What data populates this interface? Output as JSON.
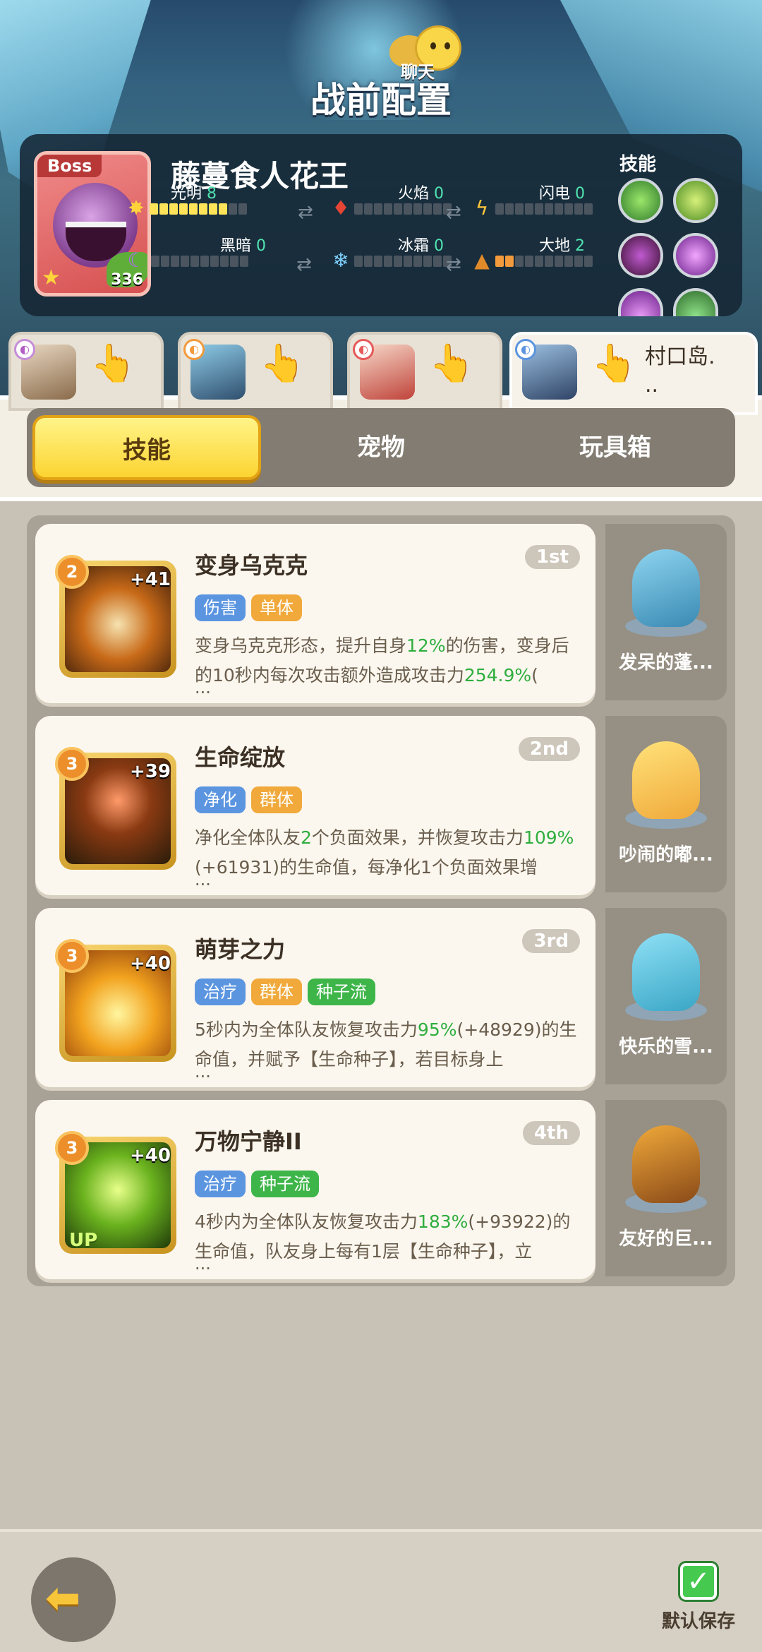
{
  "header": {
    "title": "战前配置",
    "chat_label": "聊天"
  },
  "boss": {
    "badge": "Boss",
    "name": "藤蔓食人花王",
    "level": "336",
    "skills_label": "技能",
    "attributes": [
      {
        "name": "光明",
        "value": "8"
      },
      {
        "name": "火焰",
        "value": "0"
      },
      {
        "name": "闪电",
        "value": "0"
      },
      {
        "name": "黑暗",
        "value": "0"
      },
      {
        "name": "冰霜",
        "value": "0"
      },
      {
        "name": "大地",
        "value": "2"
      }
    ]
  },
  "party_tabs": [
    {
      "name": ""
    },
    {
      "name": ""
    },
    {
      "name": ""
    },
    {
      "name": "村口岛.\n.."
    }
  ],
  "segments": [
    "技能",
    "宠物",
    "玩具箱"
  ],
  "skills": [
    {
      "level": "2",
      "plus": "+41",
      "name": "变身乌克克",
      "rank": "1st",
      "tags": [
        "伤害",
        "单体"
      ],
      "desc_a": "变身乌克克形态，提升自身",
      "desc_b": "12%",
      "desc_c": "的伤害，变身后的10秒内每次攻击额外造成攻击力",
      "desc_d": "254.9%",
      "desc_e": "(",
      "dots": "...",
      "pet": "发呆的蓬..."
    },
    {
      "level": "3",
      "plus": "+39",
      "name": "生命绽放",
      "rank": "2nd",
      "tags": [
        "净化",
        "群体"
      ],
      "desc_a": "净化全体队友",
      "desc_b": "2",
      "desc_c": "个负面效果，并恢复攻击力",
      "desc_d": "109%",
      "desc_e": "(+61931)的生命值，每净化1个负面效果增",
      "dots": "...",
      "pet": "吵闹的嘟..."
    },
    {
      "level": "3",
      "plus": "+40",
      "name": "萌芽之力",
      "rank": "3rd",
      "tags": [
        "治疗",
        "群体",
        "种子流"
      ],
      "desc_a": "5秒内为全体队友恢复攻击力",
      "desc_b": "95%",
      "desc_c": "(+48929)",
      "desc_d": "",
      "desc_e": "的生命值，并赋予【生命种子】，若目标身上",
      "dots": "...",
      "pet": "快乐的雪..."
    },
    {
      "level": "3",
      "plus": "+40",
      "up": "UP",
      "name": "万物宁静II",
      "rank": "4th",
      "tags": [
        "治疗",
        "种子流"
      ],
      "desc_a": "4秒内为全体队友恢复攻击力",
      "desc_b": "183%",
      "desc_c": "(+93922)",
      "desc_d": "",
      "desc_e": "的生命值，队友身上每有1层【生命种子】，立",
      "dots": "...",
      "pet": "友好的巨..."
    }
  ],
  "footer": {
    "save_label": "默认保存"
  }
}
